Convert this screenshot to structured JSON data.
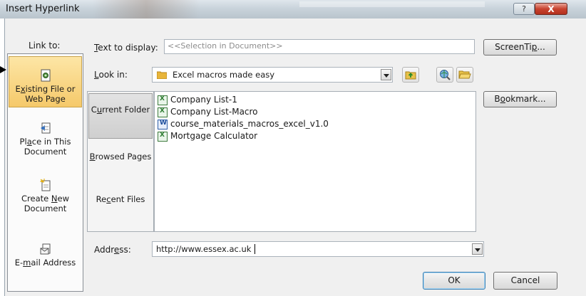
{
  "window": {
    "title": "Insert Hyperlink",
    "help_label": "?",
    "close_label": "X"
  },
  "link_to": {
    "label": "Link to:",
    "items": [
      {
        "label_pre": "E",
        "label_u": "x",
        "label_post": "isting File or Web Page",
        "icon": "existing-file-icon",
        "selected": true
      },
      {
        "label_pre": "Pl",
        "label_u": "a",
        "label_post": "ce in This Document",
        "icon": "place-in-document-icon",
        "selected": false
      },
      {
        "label_pre": "Create ",
        "label_u": "N",
        "label_post": "ew Document",
        "icon": "new-document-icon",
        "selected": false
      },
      {
        "label_pre": "E-",
        "label_u": "m",
        "label_post": "ail Address",
        "icon": "email-icon",
        "selected": false
      }
    ]
  },
  "text_to_display": {
    "label_u": "T",
    "label_rest": "ext to display:",
    "value": "<<Selection in Document>>"
  },
  "screentip_button": {
    "label_pre": "ScreenTi",
    "label_u": "p",
    "label_post": "..."
  },
  "look_in": {
    "label_pre": "",
    "label_u": "L",
    "label_post": "ook in:",
    "value": "Excel macros made easy"
  },
  "sub_nav": {
    "current_folder": {
      "pre": "C",
      "u": "u",
      "post": "rrent Folder"
    },
    "browsed_pages": {
      "pre": "",
      "u": "B",
      "post": "rowsed Pages"
    },
    "recent_files": {
      "pre": "Re",
      "u": "c",
      "post": "ent Files"
    }
  },
  "files": [
    {
      "name": "Company List-1",
      "type": "excel"
    },
    {
      "name": "Company List-Macro",
      "type": "excel"
    },
    {
      "name": "course_materials_macros_excel_v1.0",
      "type": "word"
    },
    {
      "name": "Mortgage Calculator",
      "type": "excel"
    }
  ],
  "bookmark_button": {
    "pre": "B",
    "u": "o",
    "post": "okmark..."
  },
  "address": {
    "label_pre": "Addr",
    "label_u": "e",
    "label_post": "ss:",
    "value": "http://www.essex.ac.uk"
  },
  "ok_label": "OK",
  "cancel_label": "Cancel",
  "colors": {
    "selected_nav_bg": "#f5c96a",
    "close_button": "#c8432f"
  }
}
